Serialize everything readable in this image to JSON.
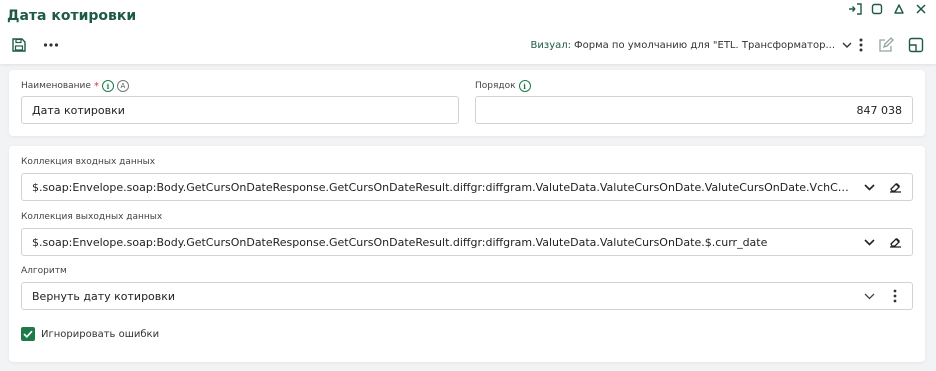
{
  "header": {
    "title": "Дата котировки",
    "visual_label": "Визуал:",
    "visual_value": "Форма по умолчанию для \"ETL. Трансформатор..."
  },
  "icons": {
    "pin": "pin-icon",
    "restore": "restore-window-icon",
    "collapse": "collapse-icon",
    "close": "close-icon",
    "save": "save-icon",
    "more": "more-horizontal-icon",
    "edit": "edit-icon",
    "panel": "panel-layout-icon"
  },
  "fields": {
    "name": {
      "label": "Наименование",
      "required_mark": "*",
      "value": "Дата котировки"
    },
    "order": {
      "label": "Порядок",
      "value": "847 038"
    },
    "input_collection": {
      "label": "Коллекция входных данных",
      "value": "$.soap:Envelope.soap:Body.GetCursOnDateResponse.GetCursOnDateResult.diffgr:diffgram.ValuteData.ValuteCursOnDate.ValuteCursOnDate.VchCode"
    },
    "output_collection": {
      "label": "Коллекция выходных данных",
      "value": "$.soap:Envelope.soap:Body.GetCursOnDateResponse.GetCursOnDateResult.diffgr:diffgram.ValuteData.ValuteCursOnDate.$.curr_date"
    },
    "algorithm": {
      "label": "Алгоритм",
      "value": "Вернуть дату котировки"
    },
    "ignore_errors": {
      "label": "Игнорировать ошибки",
      "checked": true
    }
  },
  "colors": {
    "accent": "#1e5a45",
    "check": "#1e7a4a",
    "background": "#f2f3f5"
  }
}
